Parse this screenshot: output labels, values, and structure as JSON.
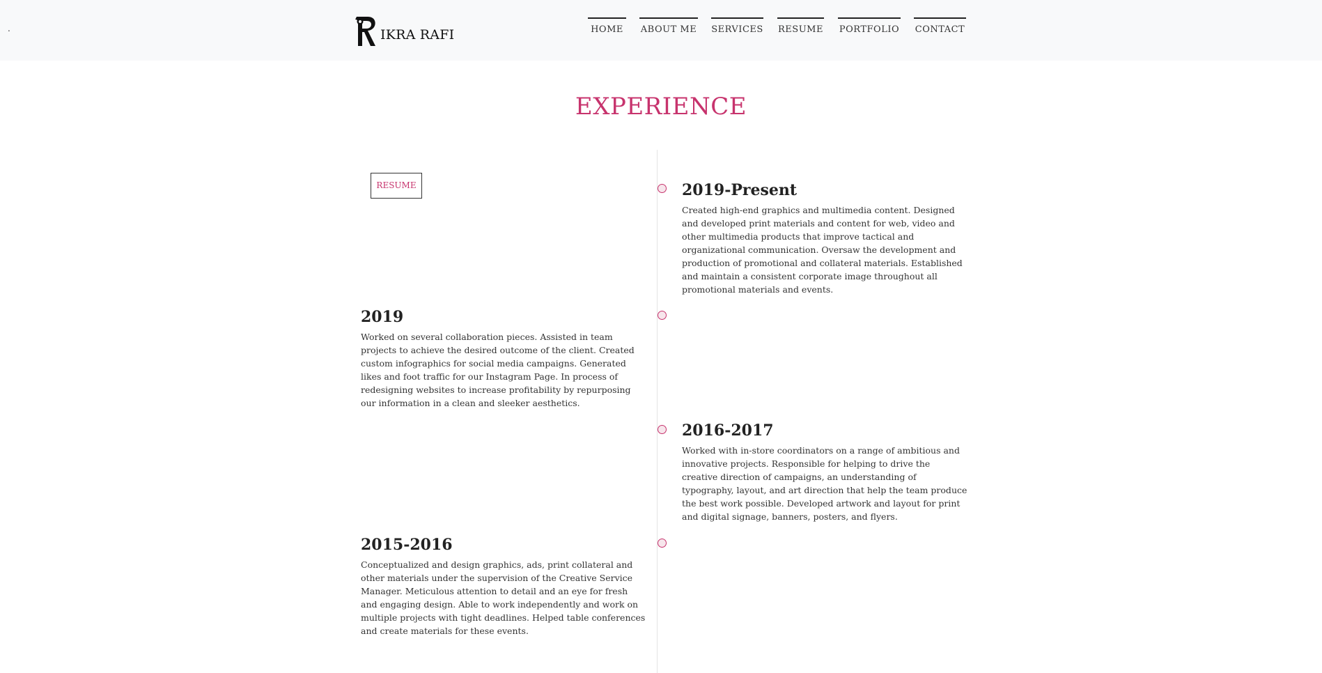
{
  "header": {
    "dot": ".",
    "logo_text": "IKRA RAFI",
    "nav": [
      {
        "label": "HOME"
      },
      {
        "label": "ABOUT ME"
      },
      {
        "label": "SERVICES"
      },
      {
        "label": "RESUME"
      },
      {
        "label": "PORTFOLIO"
      },
      {
        "label": "CONTACT"
      }
    ]
  },
  "main": {
    "title": "EXPERIENCE",
    "resume_button": "RESUME",
    "accent_color": "#c7336d",
    "entries": [
      {
        "year": "2019-Present",
        "description": "Created high-end graphics and multimedia content. Designed and developed print materials and content for web, video and other multimedia products that improve tactical and organizational communication. Oversaw the development and production of promotional and collateral materials. Established and maintain a consistent corporate image throughout all promotional materials and events."
      },
      {
        "year": "2019",
        "description": "Worked on several collaboration pieces. Assisted in team projects to achieve the desired outcome of the client. Created custom infographics for social media campaigns. Generated likes and foot traffic for our Instagram Page. In process of redesigning websites to increase profitability by repurposing our information in a clean and sleeker aesthetics."
      },
      {
        "year": "2016-2017",
        "description": "Worked with in-store coordinators on a range of ambitious and innovative projects. Responsible for helping to drive the creative direction of campaigns, an understanding of typography, layout, and art direction that help the team produce the best work possible. Developed artwork and layout for print and digital signage, banners, posters, and flyers."
      },
      {
        "year": "2015-2016",
        "description": "Conceptualized and design graphics, ads, print collateral and other materials under the supervision of the Creative Service Manager. Meticulous attention to detail and an eye for fresh and engaging design. Able to work independently and work on multiple projects with tight deadlines. Helped table conferences and create materials for these events."
      }
    ]
  }
}
